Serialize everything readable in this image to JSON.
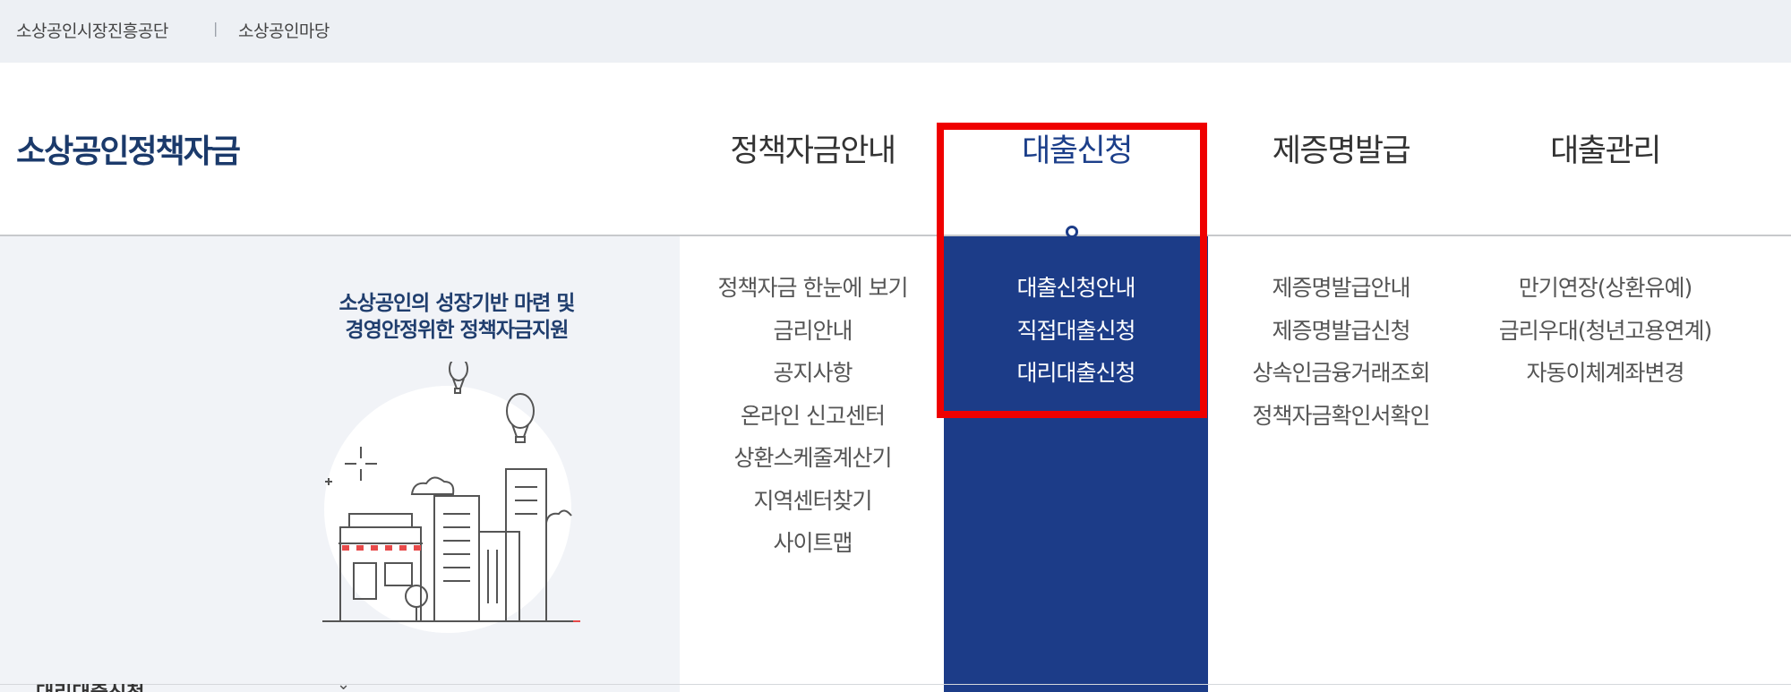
{
  "topbar": {
    "links": [
      "소상공인시장진흥공단",
      "소상공인마당"
    ],
    "separator": "|"
  },
  "header": {
    "logo": "소상공인정책자금"
  },
  "gnb": {
    "items": [
      {
        "label": "정책자금안내"
      },
      {
        "label": "대출신청",
        "active": true
      },
      {
        "label": "제증명발급"
      },
      {
        "label": "대출관리"
      }
    ]
  },
  "promo": {
    "line1": "소상공인의 성장기반 마련 및",
    "line2": "경영안정위한 정책자금지원"
  },
  "submenus": {
    "col0": [
      "정책자금 한눈에 보기",
      "금리안내",
      "공지사항",
      "온라인 신고센터",
      "상환스케줄계산기",
      "지역센터찾기",
      "사이트맵"
    ],
    "col1": [
      "대출신청안내",
      "직접대출신청",
      "대리대출신청"
    ],
    "col2": [
      "제증명발급안내",
      "제증명발급신청",
      "상속인금융거래조회",
      "정책자금확인서확인"
    ],
    "col3": [
      "만기연장(상환유예)",
      "금리우대(청년고용연계)",
      "자동이체계좌변경"
    ]
  },
  "bottom": {
    "fragment": "대리대출신청"
  },
  "colors": {
    "brand": "#1b3a6b",
    "active_panel": "#1c3c88",
    "highlight": "#ef0000",
    "topbar_bg": "#edf0f4"
  }
}
